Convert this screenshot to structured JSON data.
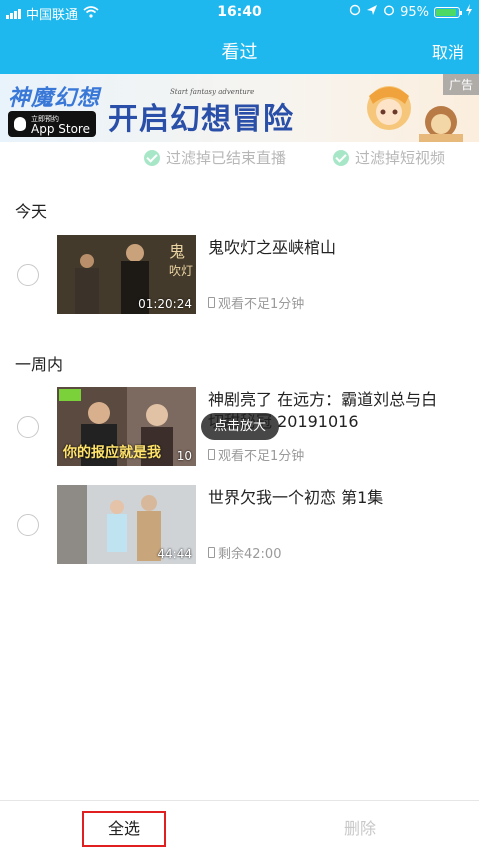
{
  "status_bar": {
    "carrier": "中国联通",
    "time": "16:40",
    "battery": "95%"
  },
  "nav": {
    "title": "看过",
    "cancel_label": "取消"
  },
  "ad_banner": {
    "logo_text": "神魔幻想",
    "store_small": "立即预约",
    "store_big": "App Store",
    "tagline_en": "Start fantasy adventure",
    "headline": "开启幻想冒险",
    "ad_label": "广告"
  },
  "filters": [
    {
      "label": "过滤掉已结束直播"
    },
    {
      "label": "过滤掉短视频"
    }
  ],
  "sections": [
    {
      "title": "今天",
      "items": [
        {
          "title": "鬼吹灯之巫峡棺山",
          "duration": "01:20:24",
          "meta": "观看不足1分钟"
        }
      ]
    },
    {
      "title": "一周内",
      "items": [
        {
          "title": "神剧亮了 在远方：霸道刘总与白",
          "title_line2": "切甜秘冠 20191016",
          "overlay_text": "你的报应就是我",
          "duration": "10",
          "meta": "观看不足1分钟"
        },
        {
          "title": "世界欠我一个初恋 第1集",
          "duration": "44:44",
          "meta": "剩余42:00"
        }
      ]
    }
  ],
  "tooltip": "点击放大",
  "bottom": {
    "select_all": "全选",
    "delete": "删除"
  },
  "colors": {
    "accent": "#1fb8ee",
    "highlight_border": "#e02020"
  }
}
